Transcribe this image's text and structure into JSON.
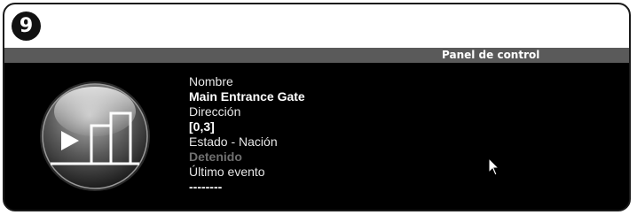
{
  "step": {
    "number": "9"
  },
  "panel": {
    "title": "Panel de control",
    "fields": {
      "name_label": "Nombre",
      "name_value": "Main Entrance Gate",
      "address_label": "Dirección",
      "address_value": "[0,3]",
      "state_label": "Estado - Nación",
      "state_value": "Detenido",
      "last_event_label": "Último evento",
      "last_event_value": "--------"
    },
    "icon": "gate-icon"
  },
  "colors": {
    "background": "#000000",
    "titlebar": "#5a5a5a",
    "dim_text": "#6f6f6f",
    "badge": "#111111"
  }
}
